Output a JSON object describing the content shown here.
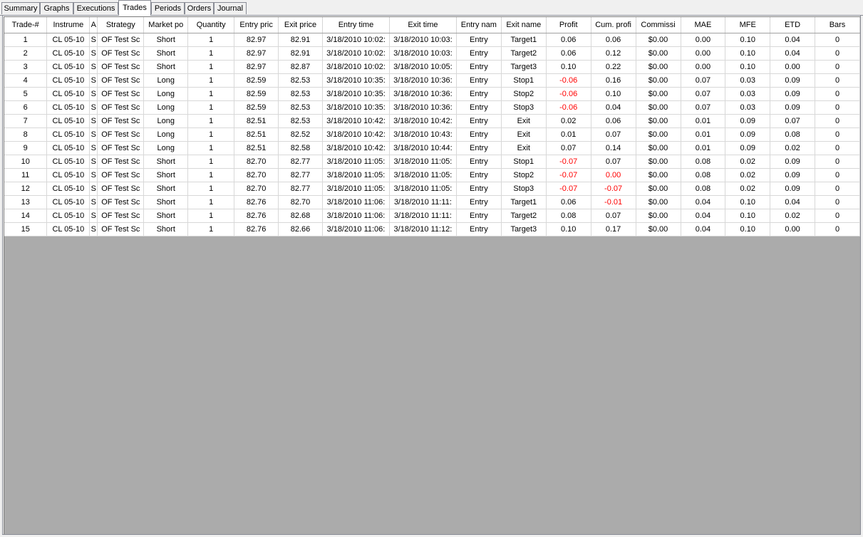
{
  "tabs": [
    {
      "label": "Summary",
      "active": false
    },
    {
      "label": "Graphs",
      "active": false
    },
    {
      "label": "Executions",
      "active": false
    },
    {
      "label": "Trades",
      "active": true
    },
    {
      "label": "Periods",
      "active": false
    },
    {
      "label": "Orders",
      "active": false
    },
    {
      "label": "Journal",
      "active": false
    }
  ],
  "columns": [
    "Trade-#",
    "Instrume",
    "A",
    "Strategy",
    "Market po",
    "Quantity",
    "Entry pric",
    "Exit price",
    "Entry time",
    "Exit time",
    "Entry nam",
    "Exit name",
    "Profit",
    "Cum. profi",
    "Commissi",
    "MAE",
    "MFE",
    "ETD",
    "Bars"
  ],
  "negative_color": "#ff0000",
  "rows": [
    [
      "1",
      "CL 05-10",
      "S",
      "OF Test Sc",
      "Short",
      "1",
      "82.97",
      "82.91",
      "3/18/2010 10:02:",
      "3/18/2010 10:03:",
      "Entry",
      "Target1",
      "0.06",
      "0.06",
      "$0.00",
      "0.00",
      "0.10",
      "0.04",
      "0"
    ],
    [
      "2",
      "CL 05-10",
      "S",
      "OF Test Sc",
      "Short",
      "1",
      "82.97",
      "82.91",
      "3/18/2010 10:02:",
      "3/18/2010 10:03:",
      "Entry",
      "Target2",
      "0.06",
      "0.12",
      "$0.00",
      "0.00",
      "0.10",
      "0.04",
      "0"
    ],
    [
      "3",
      "CL 05-10",
      "S",
      "OF Test Sc",
      "Short",
      "1",
      "82.97",
      "82.87",
      "3/18/2010 10:02:",
      "3/18/2010 10:05:",
      "Entry",
      "Target3",
      "0.10",
      "0.22",
      "$0.00",
      "0.00",
      "0.10",
      "0.00",
      "0"
    ],
    [
      "4",
      "CL 05-10",
      "S",
      "OF Test Sc",
      "Long",
      "1",
      "82.59",
      "82.53",
      "3/18/2010 10:35:",
      "3/18/2010 10:36:",
      "Entry",
      "Stop1",
      "-0.06",
      "0.16",
      "$0.00",
      "0.07",
      "0.03",
      "0.09",
      "0"
    ],
    [
      "5",
      "CL 05-10",
      "S",
      "OF Test Sc",
      "Long",
      "1",
      "82.59",
      "82.53",
      "3/18/2010 10:35:",
      "3/18/2010 10:36:",
      "Entry",
      "Stop2",
      "-0.06",
      "0.10",
      "$0.00",
      "0.07",
      "0.03",
      "0.09",
      "0"
    ],
    [
      "6",
      "CL 05-10",
      "S",
      "OF Test Sc",
      "Long",
      "1",
      "82.59",
      "82.53",
      "3/18/2010 10:35:",
      "3/18/2010 10:36:",
      "Entry",
      "Stop3",
      "-0.06",
      "0.04",
      "$0.00",
      "0.07",
      "0.03",
      "0.09",
      "0"
    ],
    [
      "7",
      "CL 05-10",
      "S",
      "OF Test Sc",
      "Long",
      "1",
      "82.51",
      "82.53",
      "3/18/2010 10:42:",
      "3/18/2010 10:42:",
      "Entry",
      "Exit",
      "0.02",
      "0.06",
      "$0.00",
      "0.01",
      "0.09",
      "0.07",
      "0"
    ],
    [
      "8",
      "CL 05-10",
      "S",
      "OF Test Sc",
      "Long",
      "1",
      "82.51",
      "82.52",
      "3/18/2010 10:42:",
      "3/18/2010 10:43:",
      "Entry",
      "Exit",
      "0.01",
      "0.07",
      "$0.00",
      "0.01",
      "0.09",
      "0.08",
      "0"
    ],
    [
      "9",
      "CL 05-10",
      "S",
      "OF Test Sc",
      "Long",
      "1",
      "82.51",
      "82.58",
      "3/18/2010 10:42:",
      "3/18/2010 10:44:",
      "Entry",
      "Exit",
      "0.07",
      "0.14",
      "$0.00",
      "0.01",
      "0.09",
      "0.02",
      "0"
    ],
    [
      "10",
      "CL 05-10",
      "S",
      "OF Test Sc",
      "Short",
      "1",
      "82.70",
      "82.77",
      "3/18/2010 11:05:",
      "3/18/2010 11:05:",
      "Entry",
      "Stop1",
      "-0.07",
      "0.07",
      "$0.00",
      "0.08",
      "0.02",
      "0.09",
      "0"
    ],
    [
      "11",
      "CL 05-10",
      "S",
      "OF Test Sc",
      "Short",
      "1",
      "82.70",
      "82.77",
      "3/18/2010 11:05:",
      "3/18/2010 11:05:",
      "Entry",
      "Stop2",
      "-0.07",
      "0.00",
      "$0.00",
      "0.08",
      "0.02",
      "0.09",
      "0"
    ],
    [
      "12",
      "CL 05-10",
      "S",
      "OF Test Sc",
      "Short",
      "1",
      "82.70",
      "82.77",
      "3/18/2010 11:05:",
      "3/18/2010 11:05:",
      "Entry",
      "Stop3",
      "-0.07",
      "-0.07",
      "$0.00",
      "0.08",
      "0.02",
      "0.09",
      "0"
    ],
    [
      "13",
      "CL 05-10",
      "S",
      "OF Test Sc",
      "Short",
      "1",
      "82.76",
      "82.70",
      "3/18/2010 11:06:",
      "3/18/2010 11:11:",
      "Entry",
      "Target1",
      "0.06",
      "-0.01",
      "$0.00",
      "0.04",
      "0.10",
      "0.04",
      "0"
    ],
    [
      "14",
      "CL 05-10",
      "S",
      "OF Test Sc",
      "Short",
      "1",
      "82.76",
      "82.68",
      "3/18/2010 11:06:",
      "3/18/2010 11:11:",
      "Entry",
      "Target2",
      "0.08",
      "0.07",
      "$0.00",
      "0.04",
      "0.10",
      "0.02",
      "0"
    ],
    [
      "15",
      "CL 05-10",
      "S",
      "OF Test Sc",
      "Short",
      "1",
      "82.76",
      "82.66",
      "3/18/2010 11:06:",
      "3/18/2010 11:12:",
      "Entry",
      "Target3",
      "0.10",
      "0.17",
      "$0.00",
      "0.04",
      "0.10",
      "0.00",
      "0"
    ]
  ],
  "red_cells": [
    [
      3,
      12
    ],
    [
      4,
      12
    ],
    [
      5,
      12
    ],
    [
      9,
      12
    ],
    [
      10,
      12
    ],
    [
      10,
      13
    ],
    [
      11,
      12
    ],
    [
      11,
      13
    ],
    [
      12,
      13
    ]
  ]
}
